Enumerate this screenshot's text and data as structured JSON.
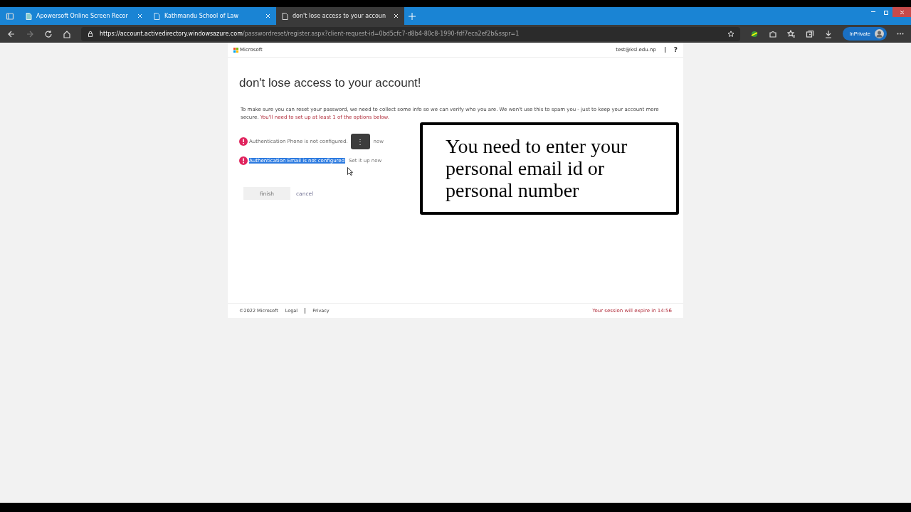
{
  "browser": {
    "tabs": [
      {
        "title": "Apowersoft Online Screen Recor",
        "selected": false
      },
      {
        "title": "Kathmandu School of Law",
        "selected": false
      },
      {
        "title": "don't lose access to your accoun",
        "selected": true
      }
    ],
    "url_host": "https://account.activedirectory.windowsazure.com",
    "url_path": "/passwordreset/register.aspx?client-request-id=0bd5cfc7-d8b4-80c8-1990-fdf7eca2ef2b&sspr=1",
    "profile": "InPrivate"
  },
  "header": {
    "brand": "Microsoft",
    "user": "test@ksl.edu.np",
    "help": "?"
  },
  "title": "don't lose access to your account!",
  "intro": "To make sure you can reset your password, we need to collect some info so we can verify who you are. We won't use this to spam you - just to keep your account more secure.",
  "requirement": "You'll need to set up at least 1 of the options below.",
  "options": [
    {
      "text": "Authentication Phone is not configured.",
      "link": "now",
      "highlighted": false,
      "menu": "⋮"
    },
    {
      "text": "Authentication Email is not configured",
      "link": "Set it up now",
      "highlighted": true
    }
  ],
  "buttons": {
    "finish": "finish",
    "cancel": "cancel"
  },
  "annotation": "You need to enter your personal email id or personal number",
  "footer": {
    "copyright": "©2022 Microsoft",
    "links": [
      "Legal",
      "Privacy"
    ],
    "session": "Your session will expire in 14:56"
  }
}
